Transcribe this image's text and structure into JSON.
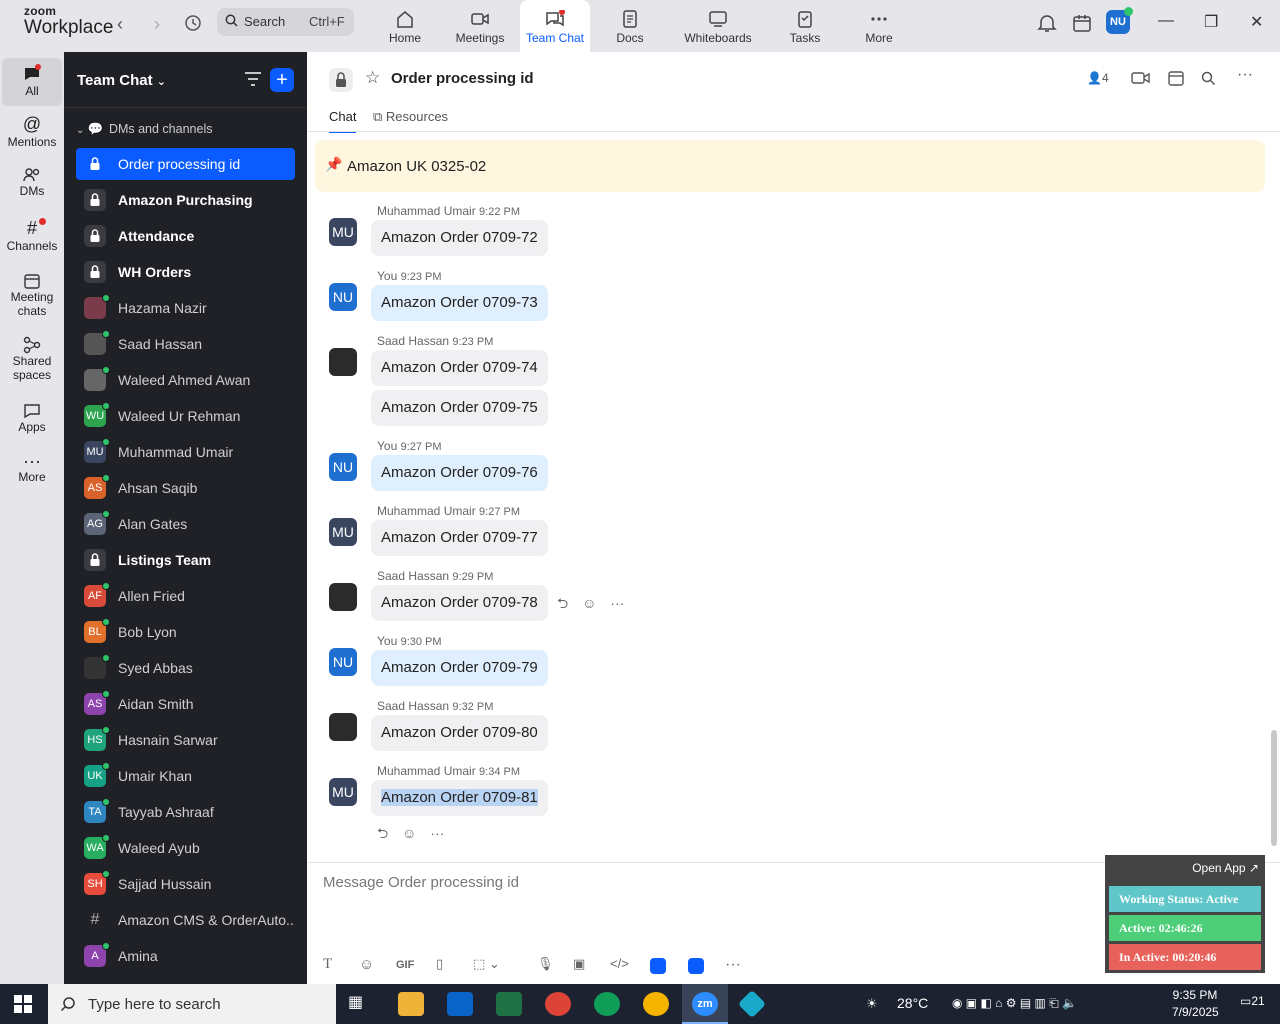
{
  "app": {
    "logo_line1": "zoom",
    "logo_line2": "Workplace",
    "search_label": "Search",
    "search_shortcut": "Ctrl+F",
    "user_initials": "NU"
  },
  "nav_tabs": [
    {
      "label": "Home",
      "icon": "home-icon"
    },
    {
      "label": "Meetings",
      "icon": "video-camera-icon"
    },
    {
      "label": "Team Chat",
      "icon": "chat-bubbles-icon"
    },
    {
      "label": "Docs",
      "icon": "document-icon"
    },
    {
      "label": "Whiteboards",
      "icon": "whiteboard-icon"
    },
    {
      "label": "Tasks",
      "icon": "tasks-icon"
    },
    {
      "label": "More",
      "icon": "more-dots-icon"
    }
  ],
  "rail": [
    {
      "label": "All"
    },
    {
      "label": "Mentions"
    },
    {
      "label": "DMs"
    },
    {
      "label": "Channels"
    },
    {
      "label": "Meeting chats"
    },
    {
      "label": "Shared spaces"
    },
    {
      "label": "Apps"
    },
    {
      "label": "More"
    }
  ],
  "sidebar": {
    "title": "Team Chat",
    "section": "DMs and channels",
    "items": [
      {
        "label": "Order processing id",
        "type": "locked",
        "active": true
      },
      {
        "label": "Amazon Purchasing",
        "type": "locked",
        "bold": true
      },
      {
        "label": "Attendance",
        "type": "locked",
        "bold": true
      },
      {
        "label": "WH Orders",
        "type": "locked",
        "bold": true
      },
      {
        "label": "Hazama Nazir",
        "initials": "",
        "color": "#7a3b4a"
      },
      {
        "label": "Saad Hassan",
        "initials": "",
        "color": "#555"
      },
      {
        "label": "Waleed Ahmed Awan",
        "initials": "",
        "color": "#666"
      },
      {
        "label": "Waleed Ur Rehman",
        "initials": "WU",
        "color": "#2ea44f"
      },
      {
        "label": "Muhammad Umair",
        "initials": "MU",
        "color": "#3a4660"
      },
      {
        "label": "Ahsan Saqib",
        "initials": "AS",
        "color": "#d9622b"
      },
      {
        "label": "Alan Gates",
        "initials": "AG",
        "color": "#5b6577"
      },
      {
        "label": "Listings Team",
        "type": "locked",
        "bold": true
      },
      {
        "label": "Allen Fried",
        "initials": "AF",
        "color": "#d84b3a"
      },
      {
        "label": "Bob Lyon",
        "initials": "BL",
        "color": "#e0702a"
      },
      {
        "label": "Syed Abbas",
        "initials": "",
        "color": "#333"
      },
      {
        "label": "Aidan Smith",
        "initials": "AS",
        "color": "#8e44ad"
      },
      {
        "label": "Hasnain Sarwar",
        "initials": "HS",
        "color": "#1fa37a"
      },
      {
        "label": "Umair Khan",
        "initials": "UK",
        "color": "#16a085"
      },
      {
        "label": "Tayyab Ashraaf",
        "initials": "TA",
        "color": "#2e86c1"
      },
      {
        "label": "Waleed Ayub",
        "initials": "WA",
        "color": "#27ae60"
      },
      {
        "label": "Sajjad Hussain",
        "initials": "SH",
        "color": "#e74c3c"
      },
      {
        "label": "Amazon CMS & OrderAuto...",
        "type": "channel"
      },
      {
        "label": "Amina",
        "initials": "A",
        "color": "#8e44ad"
      }
    ]
  },
  "channel": {
    "title": "Order processing id",
    "member_count": "4",
    "tabs": [
      "Chat",
      "Resources"
    ],
    "pinned": "Amazon UK 0325-02",
    "compose_placeholder": "Message Order processing id"
  },
  "messages": [
    {
      "sender": "Muhammad Umair",
      "time": "9:22 PM",
      "initials": "MU",
      "texts": [
        "Amazon Order 0709-72"
      ],
      "mine": false
    },
    {
      "sender": "You",
      "time": "9:23 PM",
      "initials": "NU",
      "texts": [
        "Amazon Order 0709-73"
      ],
      "mine": true
    },
    {
      "sender": "Saad Hassan",
      "time": "9:23 PM",
      "initials": "",
      "texts": [
        "Amazon Order 0709-74",
        "Amazon Order 0709-75"
      ],
      "mine": false
    },
    {
      "sender": "You",
      "time": "9:27 PM",
      "initials": "NU",
      "texts": [
        "Amazon Order 0709-76"
      ],
      "mine": true
    },
    {
      "sender": "Muhammad Umair",
      "time": "9:27 PM",
      "initials": "MU",
      "texts": [
        "Amazon Order 0709-77"
      ],
      "mine": false
    },
    {
      "sender": "Saad Hassan",
      "time": "9:29 PM",
      "initials": "",
      "texts": [
        "Amazon Order 0709-78"
      ],
      "mine": false
    },
    {
      "sender": "You",
      "time": "9:30 PM",
      "initials": "NU",
      "texts": [
        "Amazon Order 0709-79"
      ],
      "mine": true
    },
    {
      "sender": "Saad Hassan",
      "time": "9:32 PM",
      "initials": "",
      "texts": [
        "Amazon Order 0709-80"
      ],
      "mine": false
    },
    {
      "sender": "Muhammad Umair",
      "time": "9:34 PM",
      "initials": "MU",
      "texts": [
        "Amazon Order 0709-81"
      ],
      "mine": false
    }
  ],
  "compose_tools": [
    "GIF"
  ],
  "widget": {
    "open_app": "Open App ↗",
    "working_status": "Working Status: Active",
    "active": "Active: 02:46:26",
    "inactive": "In Active: 00:20:46"
  },
  "taskbar": {
    "search_placeholder": "Type here to search",
    "weather": "28°C",
    "time": "9:35 PM",
    "date": "7/9/2025",
    "notification_count": "21"
  },
  "colors": {
    "accent": "#0b5cff",
    "sidebar_bg": "#1f2126",
    "pinned_bg": "#fff6e0",
    "my_bubble": "#e0effd"
  }
}
